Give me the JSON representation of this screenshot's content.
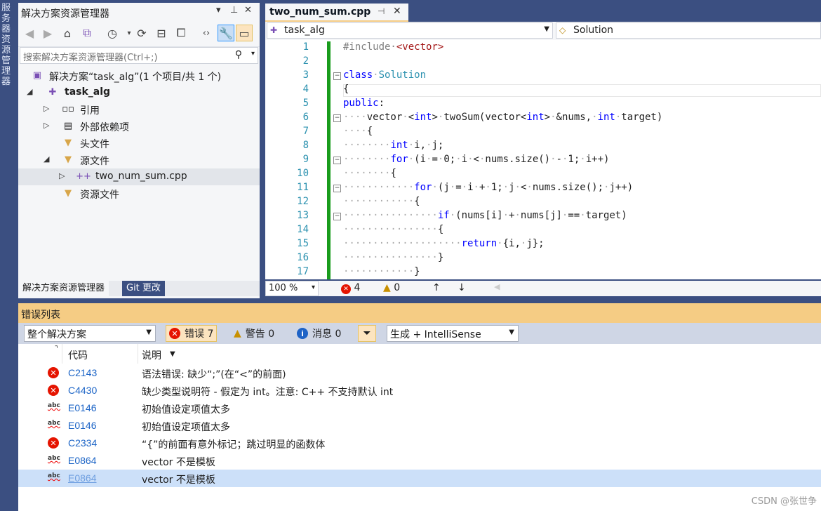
{
  "side_strip": {
    "label": "服务器资源管理器"
  },
  "solution_explorer": {
    "title": "解决方案资源管理器",
    "search_placeholder": "搜索解决方案资源管理器(Ctrl+;)",
    "tree": [
      {
        "label": "解决方案“task_alg”(1 个项目/共 1 个)",
        "icon": "solution-icon"
      },
      {
        "label": "task_alg",
        "icon": "project-icon",
        "bold": true
      },
      {
        "label": "引用",
        "icon": "references-icon"
      },
      {
        "label": "外部依赖项",
        "icon": "external-deps-icon"
      },
      {
        "label": "头文件",
        "icon": "filter-folder-icon"
      },
      {
        "label": "源文件",
        "icon": "filter-folder-icon"
      },
      {
        "label": "two_num_sum.cpp",
        "icon": "cpp-file-icon"
      },
      {
        "label": "资源文件",
        "icon": "filter-folder-icon"
      }
    ],
    "tabs": [
      "解决方案资源管理器",
      "Git 更改"
    ]
  },
  "editor": {
    "tab_title": "two_num_sum.cpp",
    "nav_left": "task_alg",
    "nav_right": "Solution",
    "line_numbers": [
      "1",
      "2",
      "3",
      "4",
      "5",
      "6",
      "7",
      "8",
      "9",
      "10",
      "11",
      "12",
      "13",
      "14",
      "15",
      "16",
      "17"
    ],
    "zoom": "100 %",
    "error_count": "4",
    "warning_count": "0"
  },
  "error_list": {
    "title": "错误列表",
    "scope": "整个解决方案",
    "errors_btn": "错误 7",
    "warnings_btn": "警告 0",
    "messages_btn": "消息 0",
    "build_filter": "生成 + IntelliSense",
    "col_code": "代码",
    "col_desc": "说明",
    "rows": [
      {
        "type": "error",
        "code": "C2143",
        "desc": "语法错误: 缺少“;”(在“<”的前面)"
      },
      {
        "type": "error",
        "code": "C4430",
        "desc": "缺少类型说明符 - 假定为 int。注意: C++ 不支持默认 int"
      },
      {
        "type": "intellisense",
        "code": "E0146",
        "desc": "初始值设定项值太多"
      },
      {
        "type": "intellisense",
        "code": "E0146",
        "desc": "初始值设定项值太多"
      },
      {
        "type": "error",
        "code": "C2334",
        "desc": "“{”的前面有意外标记；跳过明显的函数体"
      },
      {
        "type": "intellisense",
        "code": "E0864",
        "desc": "vector 不是模板"
      },
      {
        "type": "intellisense",
        "code": "E0864",
        "desc": "vector 不是模板"
      }
    ]
  },
  "watermark": "CSDN @张世争",
  "colors": {
    "accent_orange": "#f5cc84",
    "frame_blue": "#3b4f81",
    "green_bar": "#199c1d",
    "error_red": "#e51400"
  }
}
